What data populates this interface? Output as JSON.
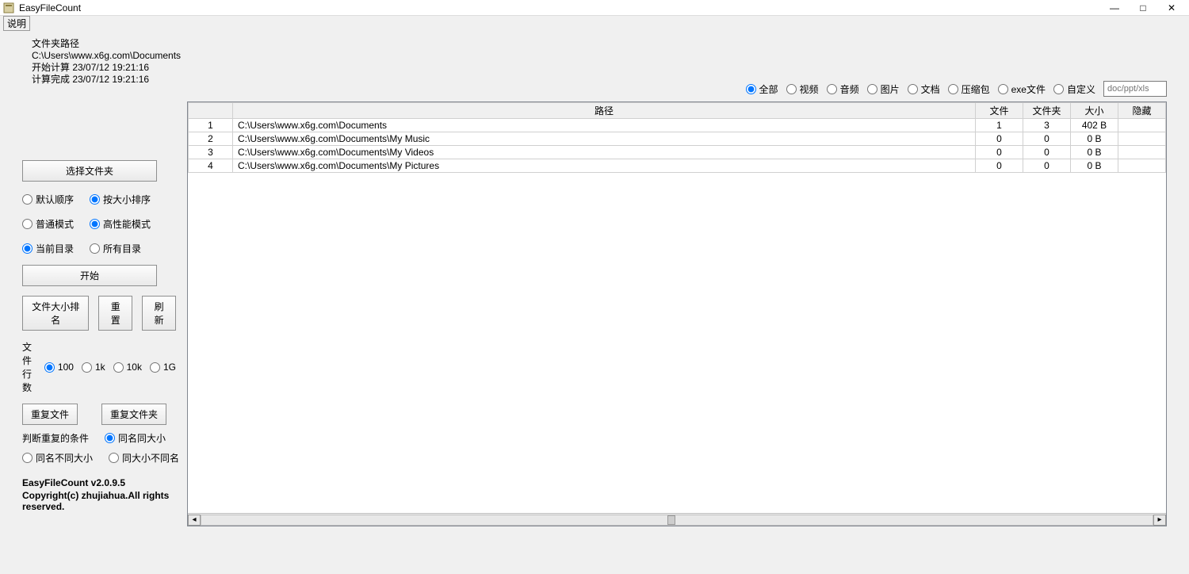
{
  "window": {
    "title": "EasyFileCount",
    "minimize": "—",
    "maximize": "□",
    "close": "✕"
  },
  "menu": {
    "item1": "说明"
  },
  "info": {
    "l1": "文件夹路径 C:\\Users\\www.x6g.com\\Documents",
    "l2": "开始计算 23/07/12 19:21:16",
    "l3": "计算完成 23/07/12 19:21:16"
  },
  "left": {
    "choose_folder": "选择文件夹",
    "sort_default": "默认顺序",
    "sort_size": "按大小排序",
    "mode_normal": "普通模式",
    "mode_high": "高性能模式",
    "dir_current": "当前目录",
    "dir_all": "所有目录",
    "start": "开始",
    "file_size_rank": "文件大小排名",
    "reset": "重置",
    "refresh": "刷新",
    "rows_label": "文件行数",
    "rows_100": "100",
    "rows_1k": "1k",
    "rows_10k": "10k",
    "rows_1g": "1G",
    "dup_files": "重复文件",
    "dup_folders": "重复文件夹",
    "dup_cond_label": "判断重复的条件",
    "dup_same_name_size": "同名同大小",
    "dup_same_name_diff_size": "同名不同大小",
    "dup_same_size_diff_name": "同大小不同名",
    "version": "EasyFileCount v2.0.9.5",
    "copyright": "Copyright(c) zhujiahua.All rights reserved."
  },
  "filters": {
    "all": "全部",
    "video": "视频",
    "audio": "音频",
    "image": "图片",
    "doc": "文档",
    "archive": "压缩包",
    "exe": "exe文件",
    "custom": "自定义",
    "custom_placeholder": "doc/ppt/xls"
  },
  "table": {
    "headers": {
      "idx": "",
      "path": "路径",
      "files": "文件",
      "folders": "文件夹",
      "size": "大小",
      "hidden": "隐藏"
    },
    "rows": [
      {
        "idx": "1",
        "path": "C:\\Users\\www.x6g.com\\Documents",
        "files": "1",
        "folders": "3",
        "size": "402 B",
        "hidden": ""
      },
      {
        "idx": "2",
        "path": "C:\\Users\\www.x6g.com\\Documents\\My Music",
        "files": "0",
        "folders": "0",
        "size": "0 B",
        "hidden": ""
      },
      {
        "idx": "3",
        "path": "C:\\Users\\www.x6g.com\\Documents\\My Videos",
        "files": "0",
        "folders": "0",
        "size": "0 B",
        "hidden": ""
      },
      {
        "idx": "4",
        "path": "C:\\Users\\www.x6g.com\\Documents\\My Pictures",
        "files": "0",
        "folders": "0",
        "size": "0 B",
        "hidden": ""
      }
    ]
  }
}
